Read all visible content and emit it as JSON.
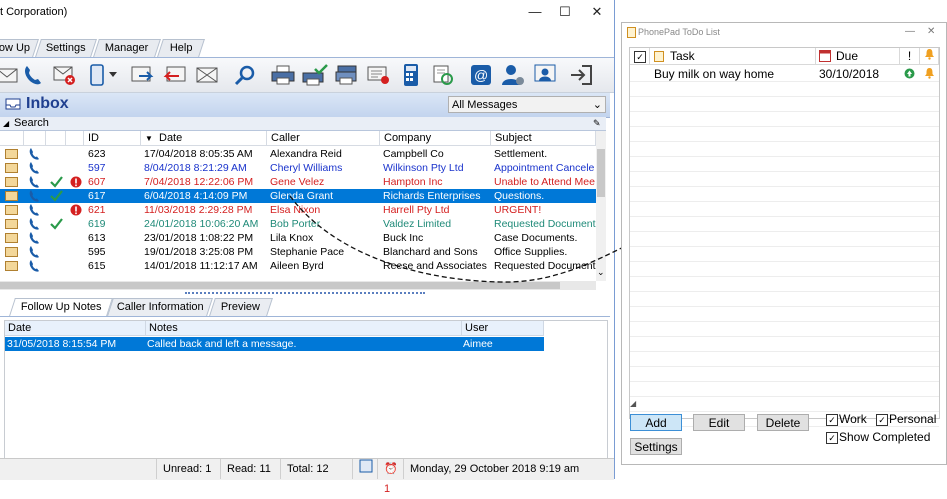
{
  "window": {
    "title": "t Corporation)",
    "minimize": "—",
    "maximize": "☐",
    "close": "✕"
  },
  "menu_tabs": [
    {
      "label": "ow Up"
    },
    {
      "label": "Settings"
    },
    {
      "label": "Manager"
    },
    {
      "label": "Help"
    }
  ],
  "toolbar_icons": [
    "mail-icon",
    "phone-call-icon",
    "delete-message-icon",
    "mobile-icon",
    "dropdown-icon",
    "forward-icon",
    "reply-icon",
    "close-envelope-icon",
    "search-icon",
    "print-icon",
    "print-check-icon",
    "print-multiple-icon",
    "email-message-icon",
    "calculator-icon",
    "refresh-icon",
    "at-email-icon",
    "user-settings-icon",
    "user-manage-icon",
    "exit-icon"
  ],
  "inbox": {
    "title": "Inbox",
    "filter": "All Messages",
    "search_label": "Search"
  },
  "columns": {
    "id": "ID",
    "date": "Date",
    "caller": "Caller",
    "company": "Company",
    "subject": "Subject"
  },
  "messages": [
    {
      "id": "623",
      "date": "17/04/2018 8:05:35 AM",
      "caller": "Alexandra Reid",
      "company": "Campbell Co",
      "subject": "Settlement.",
      "color": "#000000",
      "check": false,
      "urgent": false
    },
    {
      "id": "597",
      "date": "8/04/2018 8:21:29 AM",
      "caller": "Cheryl Williams",
      "company": "Wilkinson Pty Ltd",
      "subject": "Appointment Cancele",
      "color": "#1a33cc",
      "check": false,
      "urgent": false
    },
    {
      "id": "607",
      "date": "7/04/2018 12:22:06 PM",
      "caller": "Gene Velez",
      "company": "Hampton Inc",
      "subject": "Unable to Attend Mee",
      "color": "#d42020",
      "check": true,
      "urgent": true
    },
    {
      "id": "617",
      "date": "6/04/2018 4:14:09 PM",
      "caller": "Glenda Grant",
      "company": "Richards Enterprises",
      "subject": "Questions.",
      "color": "#ffffff",
      "check": true,
      "urgent": false,
      "selected": true
    },
    {
      "id": "621",
      "date": "11/03/2018 2:29:28 PM",
      "caller": "Elsa Nixon",
      "company": "Harrell Pty Ltd",
      "subject": "URGENT!",
      "color": "#d42020",
      "check": false,
      "urgent": true
    },
    {
      "id": "619",
      "date": "24/01/2018 10:06:20 AM",
      "caller": "Bob Porter",
      "company": "Valdez Limited",
      "subject": "Requested Document",
      "color": "#1f8a78",
      "check": true,
      "urgent": false
    },
    {
      "id": "613",
      "date": "23/01/2018 1:08:22 PM",
      "caller": "Lila Knox",
      "company": "Buck Inc",
      "subject": "Case Documents.",
      "color": "#000000",
      "check": false,
      "urgent": false
    },
    {
      "id": "595",
      "date": "19/01/2018 3:25:08 PM",
      "caller": "Stephanie Pace",
      "company": "Blanchard and Sons",
      "subject": "Office Supplies.",
      "color": "#000000",
      "check": false,
      "urgent": false
    },
    {
      "id": "615",
      "date": "14/01/2018 11:12:17 AM",
      "caller": "Aileen Byrd",
      "company": "Reese and Associates",
      "subject": "Requested Document",
      "color": "#000000",
      "check": false,
      "urgent": false
    }
  ],
  "detail_tabs": [
    {
      "label": "Follow Up Notes"
    },
    {
      "label": "Caller Information"
    },
    {
      "label": "Preview"
    }
  ],
  "notes": {
    "columns": {
      "date": "Date",
      "notes": "Notes",
      "user": "User"
    },
    "rows": [
      {
        "date": "31/05/2018 8:15:54 PM",
        "notes": "Called back and left a message.",
        "user": "Aimee"
      }
    ]
  },
  "status": {
    "unread": "Unread: 1",
    "read": "Read: 11",
    "total": "Total: 12",
    "alarm_count": "1",
    "datetime": "Monday, 29 October 2018  9:19 am"
  },
  "todo": {
    "title": "PhonePad ToDo List",
    "minimize": "—",
    "close": "✕",
    "columns": {
      "task": "Task",
      "due": "Due",
      "priority": "!"
    },
    "items": [
      {
        "task": "Buy milk on way home",
        "due": "30/10/2018"
      }
    ],
    "buttons": {
      "add": "Add",
      "edit": "Edit",
      "delete": "Delete",
      "settings": "Settings"
    },
    "filters": {
      "work": "Work",
      "personal": "Personal",
      "show_completed": "Show Completed"
    }
  },
  "colors": {
    "accent": "#0078d7",
    "urgent": "#d42020",
    "done": "#2a9a4a",
    "link": "#1a33cc"
  }
}
